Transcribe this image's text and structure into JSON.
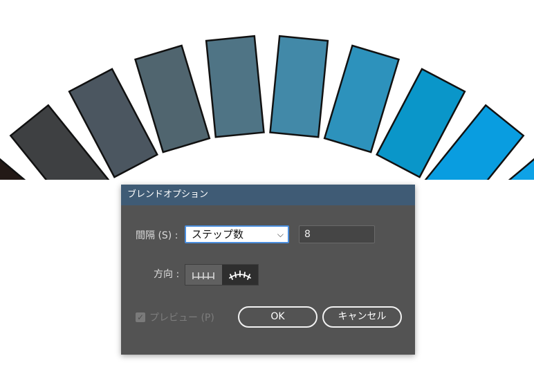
{
  "artwork": {
    "colors": [
      "#231916",
      "#3e4042",
      "#4b5660",
      "#50656f",
      "#4f7485",
      "#4289a8",
      "#2d92bc",
      "#0a96c9",
      "#099de0",
      "#0ea2e6"
    ],
    "stroke_color": "#111111"
  },
  "dialog": {
    "title": "ブレンドオプション",
    "spacing_label": "間隔 (S) :",
    "spacing_mode": "ステップ数",
    "steps_value": "8",
    "orientation_label": "方向 :",
    "orientation_buttons": [
      {
        "name": "align-to-page",
        "selected": false
      },
      {
        "name": "align-to-path",
        "selected": true
      }
    ],
    "preview_label": "プレビュー (P)",
    "preview_checked": true,
    "ok_label": "OK",
    "cancel_label": "キャンセル",
    "colors": {
      "title_bar": "#3f5b75",
      "panel": "#535353",
      "focus_border": "#4a8ede"
    }
  }
}
